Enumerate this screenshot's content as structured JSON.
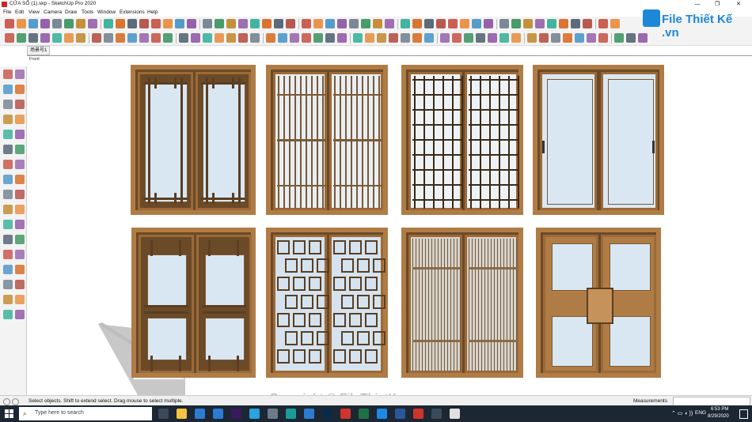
{
  "window": {
    "title": "CỬA SỔ (1).skp - SketchUp Pro 2020"
  },
  "menu": [
    "File",
    "Edit",
    "View",
    "Camera",
    "Draw",
    "Tools",
    "Window",
    "Extensions",
    "Help"
  ],
  "scene": {
    "tab": "场景号1",
    "view_label": "Front"
  },
  "status": {
    "hint": "Select objects. Shift to extend select. Drag mouse to select multiple.",
    "measurements_label": "Measurements"
  },
  "watermark": {
    "brand": "File Thiết Kế .vn",
    "copyright": "Copyright © FileThietKe.vn"
  },
  "taskbar": {
    "search_placeholder": "Type here to search",
    "language": "ENG",
    "time": "6:53 PM",
    "date": "8/29/2020"
  },
  "colors": {
    "wood": "#b07c45",
    "glass": "#dbe8f2",
    "taskbar": "#1c2733",
    "brand": "#1e88d8"
  }
}
